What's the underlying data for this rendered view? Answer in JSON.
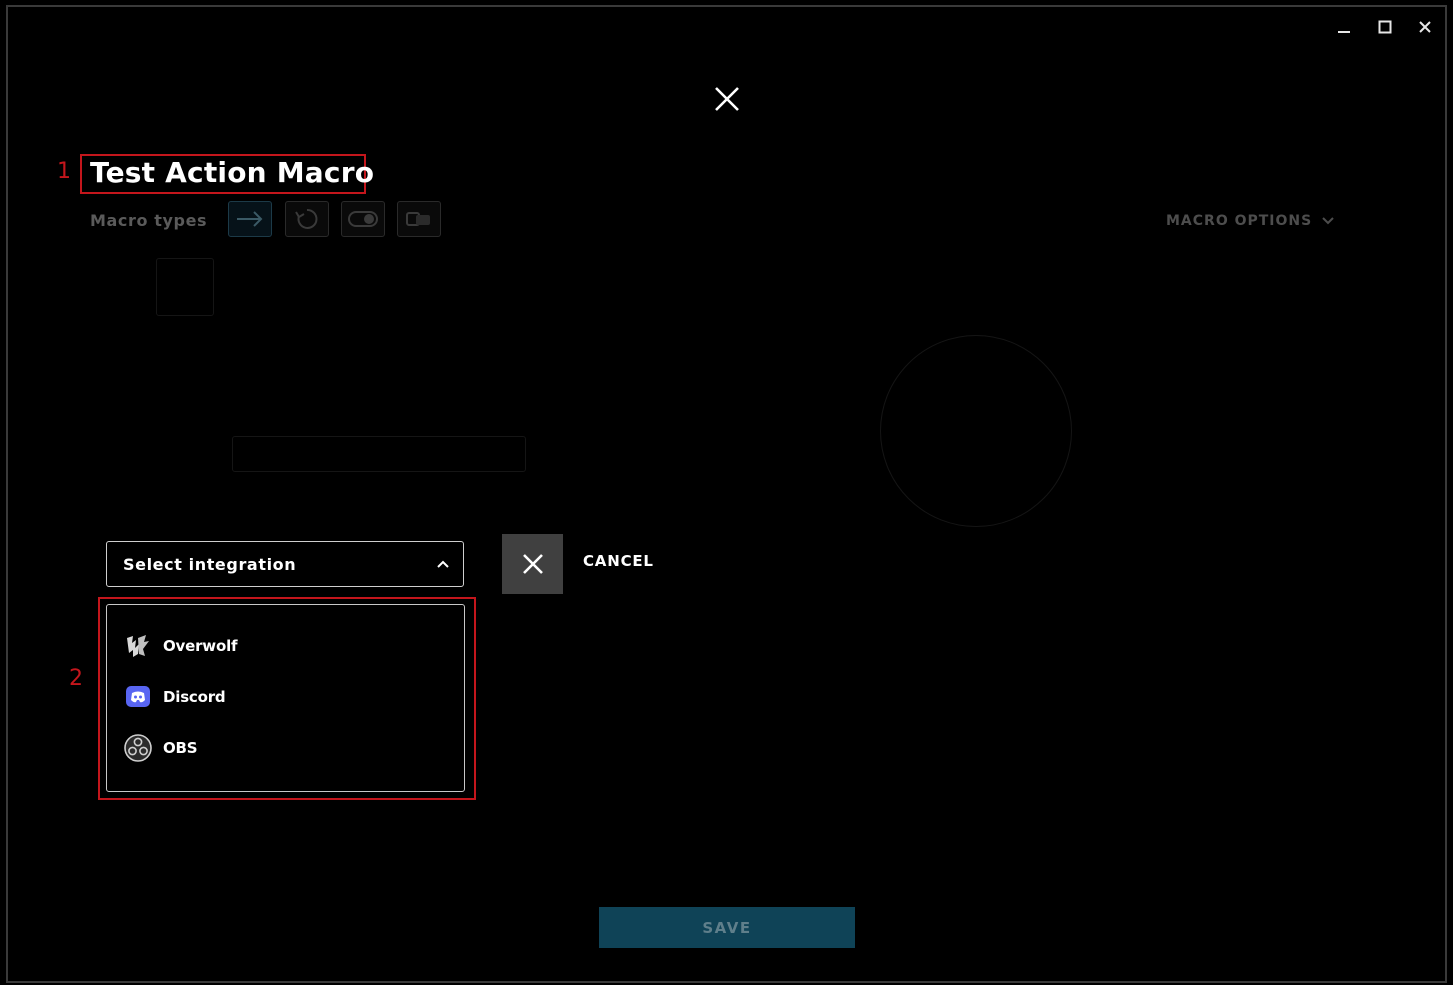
{
  "window_controls": {
    "minimize_icon": "minimize-icon",
    "maximize_icon": "maximize-icon",
    "close_icon": "close-icon"
  },
  "modal": {
    "close_icon": "close-x-icon",
    "title": "Test Action Macro",
    "macro_types_label": "Macro types",
    "macro_types": [
      "arrow-icon",
      "repeat-icon",
      "toggle-icon",
      "sequence-icon"
    ],
    "macro_options_label": "MACRO OPTIONS"
  },
  "annotations": {
    "marker_1": "1",
    "marker_2": "2",
    "color": "#c4161c"
  },
  "integration": {
    "select_label": "Select integration",
    "cancel_label": "CANCEL",
    "options": [
      {
        "label": "Overwolf",
        "icon": "overwolf-icon"
      },
      {
        "label": "Discord",
        "icon": "discord-icon"
      },
      {
        "label": "OBS",
        "icon": "obs-icon"
      }
    ]
  },
  "footer": {
    "save_label": "SAVE",
    "save_color": "#0f4357"
  }
}
